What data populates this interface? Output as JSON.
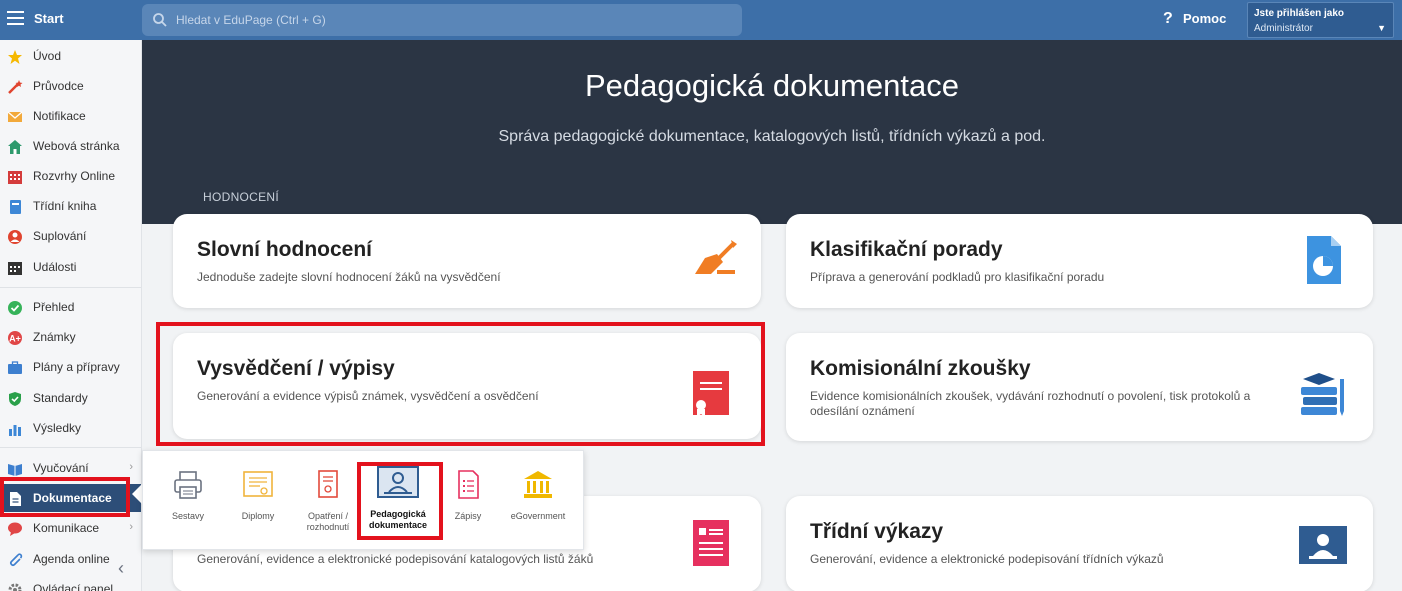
{
  "topbar": {
    "start_label": "Start",
    "search_placeholder": "Hledat v EduPage (Ctrl + G)",
    "help_label": "Pomoc",
    "user_line1": "Jste přihlášen jako",
    "user_line2": "Administrátor"
  },
  "sidebar": {
    "items": [
      {
        "label": "Úvod",
        "icon": "star-icon",
        "color": "#f5b800"
      },
      {
        "label": "Průvodce",
        "icon": "magic-wand-icon",
        "color": "#e0442f"
      },
      {
        "label": "Notifikace",
        "icon": "envelope-icon",
        "color": "#f2a93b"
      },
      {
        "label": "Webová stránka",
        "icon": "house-icon",
        "color": "#2e9a6d"
      },
      {
        "label": "Rozvrhy Online",
        "icon": "timetable-icon",
        "color": "#d43c3c"
      },
      {
        "label": "Třídní kniha",
        "icon": "book-icon",
        "color": "#3d87d6"
      },
      {
        "label": "Suplování",
        "icon": "substitute-icon",
        "color": "#e0442f"
      },
      {
        "label": "Události",
        "icon": "calendar-icon",
        "color": "#333333"
      },
      {
        "label": "Přehled",
        "icon": "check-circle-icon",
        "color": "#36b35a"
      },
      {
        "label": "Známky",
        "icon": "grades-icon",
        "color": "#e04646"
      },
      {
        "label": "Plány a přípravy",
        "icon": "briefcase-icon",
        "color": "#3d7fcf"
      },
      {
        "label": "Standardy",
        "icon": "shield-icon",
        "color": "#2aa04a"
      },
      {
        "label": "Výsledky",
        "icon": "bar-chart-icon",
        "color": "#3d87d6"
      },
      {
        "label": "Vyučování",
        "icon": "open-book-icon",
        "color": "#3d7fcf"
      },
      {
        "label": "Dokumentace",
        "icon": "document-icon",
        "color": "#ffffff"
      },
      {
        "label": "Komunikace",
        "icon": "chat-icon",
        "color": "#e04646"
      },
      {
        "label": "Agenda online",
        "icon": "paperclip-icon",
        "color": "#3d7fcf"
      },
      {
        "label": "Ovládací panel",
        "icon": "cog-icon",
        "color": "#777777"
      }
    ]
  },
  "hero": {
    "title": "Pedagogická dokumentace",
    "subtitle": "Správa pedagogické dokumentace, katalogových listů, třídních výkazů a pod."
  },
  "section_label": "HODNOCENÍ",
  "cards": [
    {
      "title": "Slovní hodnocení",
      "desc": "Jednoduše zadejte slovní hodnocení žáků na vysvědčení",
      "icon": "hand-writing-icon"
    },
    {
      "title": "Klasifikační porady",
      "desc": "Příprava a generování podkladů pro klasifikační poradu",
      "icon": "pie-chart-document-icon"
    },
    {
      "title": "Vysvědčení / výpisy",
      "desc": "Generování a evidence výpisů známek, vysvědčení a osvědčení",
      "icon": "certificate-icon"
    },
    {
      "title": "Komisionální zkoušky",
      "desc": "Evidence komisionálních zkoušek, vydávání rozhodnutí o povolení, tisk protokolů a odesílání oznámení",
      "icon": "books-stack-icon"
    },
    {
      "title": "",
      "desc": "Generování, evidence a elektronické podepisování katalogových listů žáků",
      "icon": "catalog-sheet-icon"
    },
    {
      "title": "Třídní výkazy",
      "desc": "Generování, evidence a elektronické podepisování třídních výkazů",
      "icon": "class-report-icon"
    }
  ],
  "flyout": {
    "items": [
      {
        "label": "Sestavy",
        "icon": "printer-icon"
      },
      {
        "label": "Diplomy",
        "icon": "diploma-icon"
      },
      {
        "label": "Opatření / rozhodnutí",
        "icon": "decision-icon"
      },
      {
        "label": "Pedagogická dokumentace",
        "icon": "pedagogical-doc-icon"
      },
      {
        "label": "Zápisy",
        "icon": "list-doc-icon"
      },
      {
        "label": "eGovernment",
        "icon": "government-building-icon"
      }
    ]
  }
}
